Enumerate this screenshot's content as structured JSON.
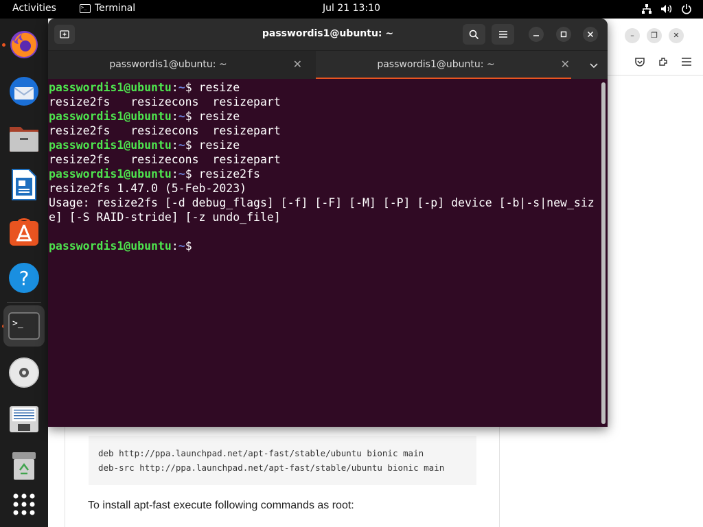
{
  "topbar": {
    "activities": "Activities",
    "app_name": "Terminal",
    "clock": "Jul 21  13:10",
    "tray_icons": [
      "network-icon",
      "volume-icon",
      "power-icon"
    ]
  },
  "dock": {
    "items": [
      {
        "name": "firefox",
        "running": true
      },
      {
        "name": "thunderbird",
        "running": false
      },
      {
        "name": "files",
        "running": false
      },
      {
        "name": "libreoffice-writer",
        "running": false
      },
      {
        "name": "ubuntu-software",
        "running": false
      },
      {
        "name": "help",
        "running": false
      },
      {
        "name": "terminal",
        "running": true,
        "active": true
      },
      {
        "name": "disc",
        "running": false
      },
      {
        "name": "document",
        "running": false
      },
      {
        "name": "trash",
        "running": false
      },
      {
        "name": "show-apps",
        "running": false
      }
    ]
  },
  "browser": {
    "code_lines": [
      "deb http://ppa.launchpad.net/apt-fast/stable/ubuntu bionic main",
      "deb-src http://ppa.launchpad.net/apt-fast/stable/ubuntu bionic main"
    ],
    "prose": "To install apt-fast execute following commands as root:"
  },
  "terminal": {
    "title": "passwordis1@ubuntu: ~",
    "tabs": [
      {
        "label": "passwordis1@ubuntu: ~",
        "active": false
      },
      {
        "label": "passwordis1@ubuntu: ~",
        "active": true
      }
    ],
    "prompt_user": "passwordis1@ubuntu",
    "prompt_sep": ":",
    "prompt_path": "~",
    "prompt_dollar": "$ ",
    "lines": [
      {
        "type": "prompt",
        "cmd": "resize"
      },
      {
        "type": "output",
        "text": "resize2fs   resizecons  resizepart"
      },
      {
        "type": "prompt",
        "cmd": "resize"
      },
      {
        "type": "output",
        "text": "resize2fs   resizecons  resizepart"
      },
      {
        "type": "prompt",
        "cmd": "resize"
      },
      {
        "type": "output",
        "text": "resize2fs   resizecons  resizepart"
      },
      {
        "type": "prompt",
        "cmd": "resize2fs"
      },
      {
        "type": "output",
        "text": "resize2fs 1.47.0 (5-Feb-2023)"
      },
      {
        "type": "output",
        "text": "Usage: resize2fs [-d debug_flags] [-f] [-F] [-M] [-P] [-p] device [-b|-s|new_siz"
      },
      {
        "type": "output",
        "text": "e] [-S RAID-stride] [-z undo_file]"
      },
      {
        "type": "output",
        "text": ""
      },
      {
        "type": "prompt",
        "cmd": ""
      }
    ]
  },
  "colors": {
    "terminal_bg": "#300a24",
    "prompt_user": "#4ee44e",
    "prompt_path": "#6b7fd7",
    "accent": "#e95420"
  }
}
